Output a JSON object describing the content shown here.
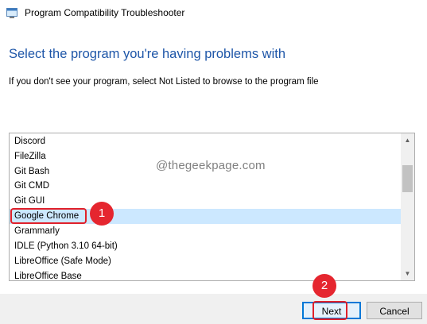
{
  "window": {
    "title": "Program Compatibility Troubleshooter"
  },
  "heading": "Select the program you're having problems with",
  "instruction": "If you don't see your program, select Not Listed to browse to the program file",
  "program_list": {
    "items": [
      {
        "label": "Discord"
      },
      {
        "label": "FileZilla"
      },
      {
        "label": "Git Bash"
      },
      {
        "label": "Git CMD"
      },
      {
        "label": "Git GUI"
      },
      {
        "label": "Google Chrome",
        "selected": true
      },
      {
        "label": "Grammarly"
      },
      {
        "label": "IDLE (Python 3.10 64-bit)"
      },
      {
        "label": "LibreOffice (Safe Mode)"
      },
      {
        "label": "LibreOffice Base"
      }
    ]
  },
  "watermark": "@thegeekpage.com",
  "annotations": {
    "step1": "1",
    "step2": "2"
  },
  "buttons": {
    "next": "Next",
    "cancel": "Cancel"
  },
  "colors": {
    "heading": "#1e56a8",
    "selection": "#cce8ff",
    "annotation": "#e5262f",
    "default_button_border": "#0078d7"
  }
}
